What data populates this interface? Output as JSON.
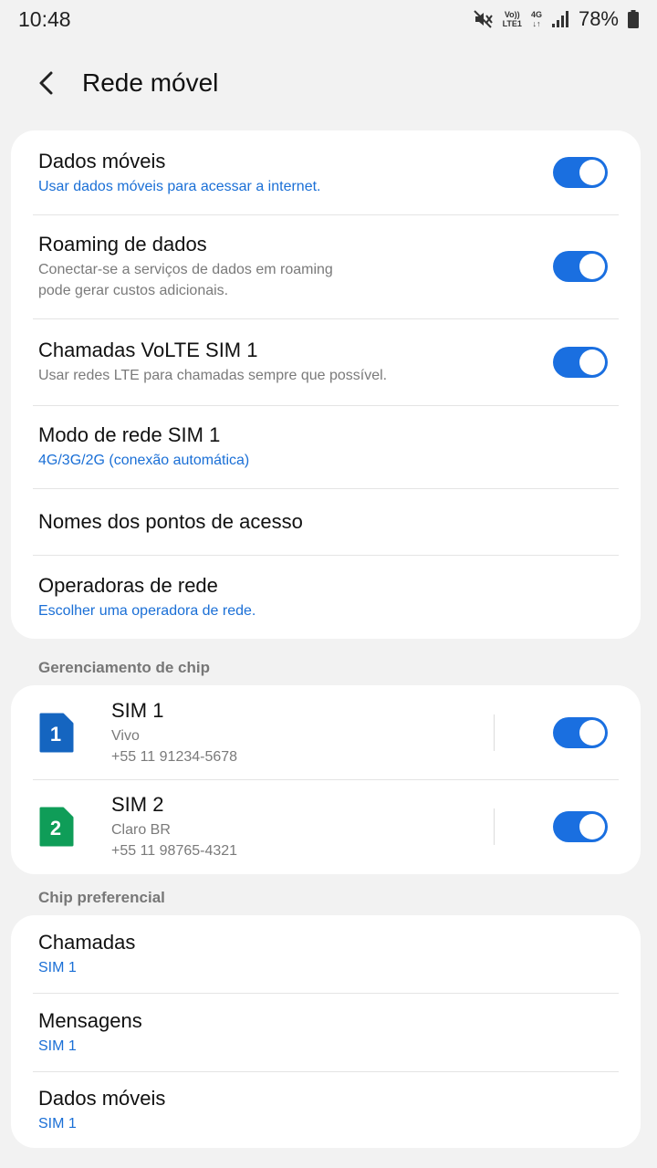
{
  "status_bar": {
    "time": "10:48",
    "volte_top": "Vo))",
    "volte_bottom": "LTE1",
    "net_top": "4G",
    "net_bottom": "↓↑",
    "battery": "78%"
  },
  "header": {
    "title": "Rede móvel"
  },
  "settings": [
    {
      "title": "Dados móveis",
      "subtitle": "Usar dados móveis para acessar a internet.",
      "subtitle_style": "blue",
      "toggle": true
    },
    {
      "title": "Roaming de dados",
      "subtitle": "Conectar-se a serviços de dados em roaming\npode gerar custos adicionais.",
      "subtitle_style": "gray",
      "toggle": true
    },
    {
      "title": "Chamadas VoLTE SIM 1",
      "subtitle": "Usar redes LTE para chamadas sempre que possível.",
      "subtitle_style": "gray",
      "toggle": true
    },
    {
      "title": "Modo de rede SIM 1",
      "subtitle": "4G/3G/2G (conexão automática)",
      "subtitle_style": "blue",
      "toggle": false
    },
    {
      "title": "Nomes dos pontos de acesso",
      "subtitle": "",
      "toggle": false
    },
    {
      "title": "Operadoras de rede",
      "subtitle": "Escolher uma operadora de rede.",
      "subtitle_style": "blue",
      "toggle": false
    }
  ],
  "chip_section": {
    "label": "Gerenciamento de chip",
    "sims": [
      {
        "number": "1",
        "name": "SIM 1",
        "carrier": "Vivo",
        "phone": "+55 11 91234-5678",
        "color": "#1565c0",
        "enabled": true
      },
      {
        "number": "2",
        "name": "SIM 2",
        "carrier": "Claro BR",
        "phone": "+55 11 98765-4321",
        "color": "#0f9d58",
        "enabled": true
      }
    ]
  },
  "preferred_section": {
    "label": "Chip preferencial",
    "items": [
      {
        "title": "Chamadas",
        "value": "SIM 1"
      },
      {
        "title": "Mensagens",
        "value": "SIM 1"
      },
      {
        "title": "Dados móveis",
        "value": "SIM 1"
      }
    ]
  },
  "colors": {
    "accent": "#1a6fe0",
    "link": "#1a6fd6",
    "background": "#f2f2f2"
  }
}
